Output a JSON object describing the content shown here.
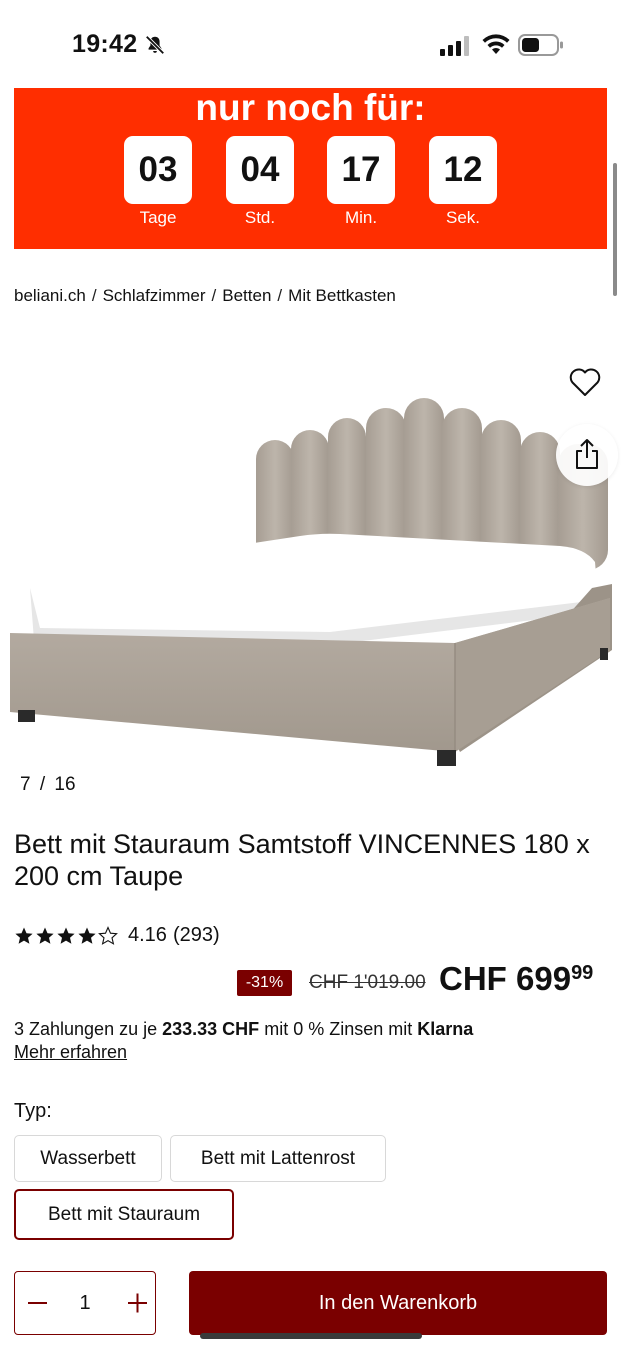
{
  "status_bar": {
    "time": "19:42"
  },
  "banner": {
    "title": "nur noch für:",
    "countdown": [
      {
        "value": "03",
        "label": "Tage"
      },
      {
        "value": "04",
        "label": "Std."
      },
      {
        "value": "17",
        "label": "Min."
      },
      {
        "value": "12",
        "label": "Sek."
      }
    ],
    "color": "#ff2e00"
  },
  "breadcrumb": [
    "beliani.ch",
    "Schlafzimmer",
    "Betten",
    "Mit Bettkasten"
  ],
  "gallery": {
    "current": "7",
    "separator": "/",
    "total": "16"
  },
  "product": {
    "title": "Bett mit Stauraum Samtstoff VINCENNES 180 x 200 cm Taupe",
    "rating_value": "4.16",
    "rating_count": "(293)",
    "rating_stars": 4.16,
    "discount": "-31%",
    "old_price": "CHF 1'019.00",
    "price_main": "CHF 699",
    "price_cents": "99"
  },
  "klarna": {
    "prefix": "3 Zahlungen zu je",
    "amount": "233.33 CHF",
    "middle": "mit 0 % Zinsen mit",
    "brand": "Klarna",
    "more": "Mehr erfahren"
  },
  "type_selector": {
    "label": "Typ:",
    "options": [
      "Wasserbett",
      "Bett mit Lattenrost",
      "Bett mit Stauraum"
    ],
    "selected": "Bett mit Stauraum"
  },
  "cart": {
    "quantity": "1",
    "button": "In den Warenkorb"
  },
  "colors": {
    "accent": "#7a0000",
    "banner": "#ff2e00"
  }
}
